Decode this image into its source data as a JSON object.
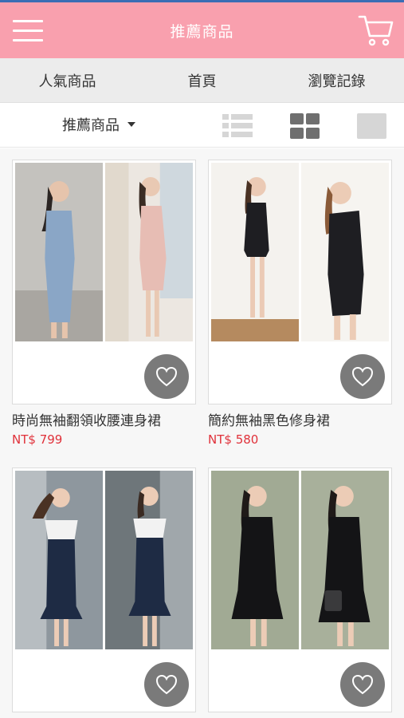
{
  "header": {
    "title": "推薦商品"
  },
  "nav": {
    "items": [
      "人氣商品",
      "首頁",
      "瀏覽記錄"
    ]
  },
  "toolbar": {
    "sort_label": "推薦商品"
  },
  "products": [
    {
      "name": "時尚無袖翻領收腰連身裙",
      "price": "NT$ 799"
    },
    {
      "name": "簡約無袖黑色修身裙",
      "price": "NT$ 580"
    },
    {
      "name": "",
      "price": ""
    },
    {
      "name": "",
      "price": ""
    }
  ],
  "colors": {
    "header_bg": "#f9a0ae",
    "price": "#e0313a",
    "fav_button": "#7a7a7a"
  }
}
